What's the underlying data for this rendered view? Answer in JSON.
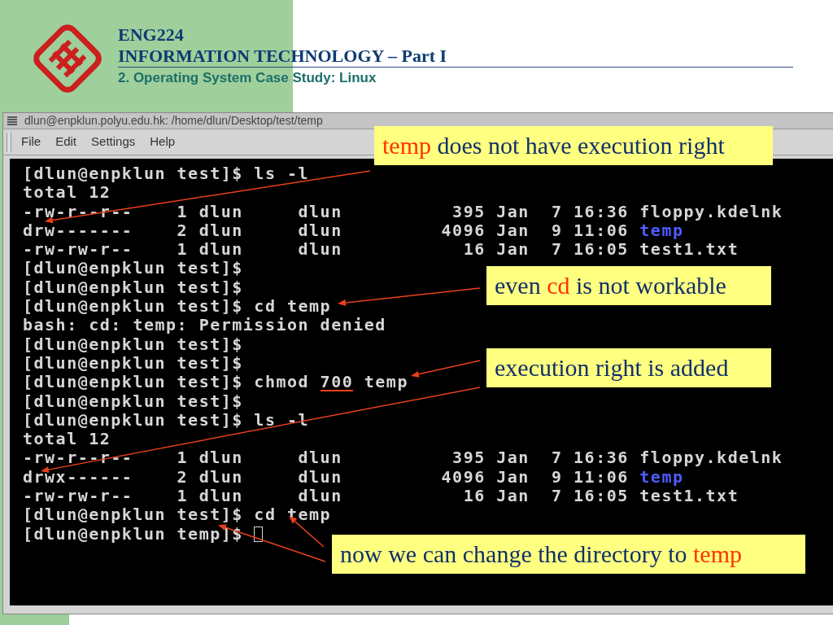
{
  "slide": {
    "course": "ENG224",
    "title": "INFORMATION TECHNOLOGY – Part I",
    "subtitle": "2. Operating System Case Study: Linux"
  },
  "window": {
    "title": "dlun@enpklun.polyu.edu.hk: /home/dlun/Desktop/test/temp",
    "menu": [
      "File",
      "Edit",
      "Settings",
      "Help"
    ]
  },
  "terminal": {
    "lines": [
      {
        "segments": [
          {
            "kind": "plain",
            "text": "[dlun@enpklun test]$ ls -l"
          }
        ],
        "cursor": false
      },
      {
        "segments": [
          {
            "kind": "plain",
            "text": "total 12"
          }
        ],
        "cursor": false
      },
      {
        "segments": [
          {
            "kind": "plain",
            "text": "-rw-r--r--    1 dlun     dlun          395 Jan  7 16:36 floppy.kdelnk"
          }
        ],
        "cursor": false
      },
      {
        "segments": [
          {
            "kind": "plain",
            "text": "drw-------    2 dlun     dlun         4096 Jan  9 11:06 "
          },
          {
            "kind": "dir",
            "text": "temp"
          }
        ],
        "cursor": false
      },
      {
        "segments": [
          {
            "kind": "plain",
            "text": "-rw-rw-r--    1 dlun     dlun           16 Jan  7 16:05 test1.txt"
          }
        ],
        "cursor": false
      },
      {
        "segments": [
          {
            "kind": "plain",
            "text": "[dlun@enpklun test]$"
          }
        ],
        "cursor": false
      },
      {
        "segments": [
          {
            "kind": "plain",
            "text": "[dlun@enpklun test]$"
          }
        ],
        "cursor": false
      },
      {
        "segments": [
          {
            "kind": "plain",
            "text": "[dlun@enpklun test]$ cd temp"
          }
        ],
        "cursor": false
      },
      {
        "segments": [
          {
            "kind": "plain",
            "text": "bash: cd: temp: Permission denied"
          }
        ],
        "cursor": false
      },
      {
        "segments": [
          {
            "kind": "plain",
            "text": "[dlun@enpklun test]$"
          }
        ],
        "cursor": false
      },
      {
        "segments": [
          {
            "kind": "plain",
            "text": "[dlun@enpklun test]$"
          }
        ],
        "cursor": false
      },
      {
        "segments": [
          {
            "kind": "plain",
            "text": "[dlun@enpklun test]$ chmod "
          },
          {
            "kind": "marked",
            "text": "700"
          },
          {
            "kind": "plain",
            "text": " temp"
          }
        ],
        "cursor": false
      },
      {
        "segments": [
          {
            "kind": "plain",
            "text": "[dlun@enpklun test]$"
          }
        ],
        "cursor": false
      },
      {
        "segments": [
          {
            "kind": "plain",
            "text": "[dlun@enpklun test]$ ls -l"
          }
        ],
        "cursor": false
      },
      {
        "segments": [
          {
            "kind": "plain",
            "text": "total 12"
          }
        ],
        "cursor": false
      },
      {
        "segments": [
          {
            "kind": "plain",
            "text": "-rw-r--r--    1 dlun     dlun          395 Jan  7 16:36 floppy.kdelnk"
          }
        ],
        "cursor": false
      },
      {
        "segments": [
          {
            "kind": "plain",
            "text": "drwx------    2 dlun     dlun         4096 Jan  9 11:06 "
          },
          {
            "kind": "dir",
            "text": "temp"
          }
        ],
        "cursor": false
      },
      {
        "segments": [
          {
            "kind": "plain",
            "text": "-rw-rw-r--    1 dlun     dlun           16 Jan  7 16:05 test1.txt"
          }
        ],
        "cursor": false
      },
      {
        "segments": [
          {
            "kind": "plain",
            "text": "[dlun@enpklun test]$ cd temp"
          }
        ],
        "cursor": false
      },
      {
        "segments": [
          {
            "kind": "plain",
            "text": "[dlun@enpklun temp]$ "
          }
        ],
        "cursor": true
      }
    ]
  },
  "callouts": [
    {
      "parts": [
        {
          "text": "temp",
          "emphasis": true
        },
        {
          "text": " does not have execution right",
          "emphasis": false
        }
      ]
    },
    {
      "parts": [
        {
          "text": "even ",
          "emphasis": false
        },
        {
          "text": "cd",
          "emphasis": true
        },
        {
          "text": " is not workable",
          "emphasis": false
        }
      ]
    },
    {
      "parts": [
        {
          "text": "execution right is added",
          "emphasis": false
        }
      ]
    },
    {
      "parts": [
        {
          "text": "now we can change the directory to ",
          "emphasis": false
        },
        {
          "text": "temp",
          "emphasis": true
        }
      ]
    }
  ]
}
